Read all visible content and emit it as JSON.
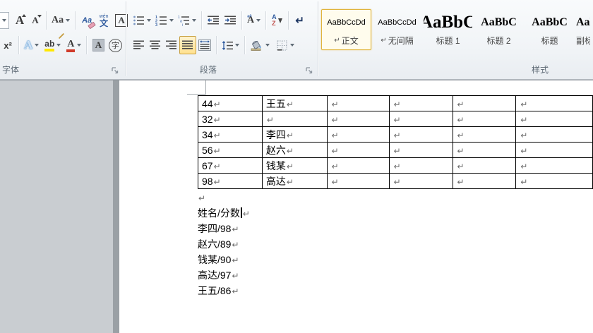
{
  "colors": {
    "ribbon_bg": "#f1f4f7",
    "selected_toggle_fill": "#ffe18f",
    "selected_toggle_border": "#c79f3f",
    "style_selected_border": "#e0b43c",
    "highlight_yellow": "#ffe800",
    "font_color_red": "#d03a2a",
    "canvas_gray": "#c9cdd1",
    "table_border": "#000000"
  },
  "ribbon": {
    "font": {
      "label": "字体",
      "grow_glyph": "A",
      "shrink_glyph": "A",
      "change_case_glyph": "Aa",
      "clear_format_glyph": "Aa",
      "phonetic_top": "wén",
      "phonetic_bottom": "文",
      "char_border_glyph": "A",
      "superscript_glyph": "x²",
      "text_effects_glyph": "A",
      "highlight_glyph": "ab",
      "font_color_glyph": "A",
      "char_shading_glyph": "A",
      "enclose_glyph": "字"
    },
    "paragraph": {
      "label": "段落",
      "sort_a": "A",
      "sort_z": "Z",
      "asian_layout_glyph": "A",
      "show_marks_glyph": "↵"
    },
    "styles": {
      "label": "样式",
      "items": [
        {
          "sample": "AaBbCcDd",
          "mark": "↵",
          "name": "正文"
        },
        {
          "sample": "AaBbCcDd",
          "mark": "↵",
          "name": "无间隔"
        },
        {
          "sample": "AaBbC",
          "name": "标题 1"
        },
        {
          "sample": "AaBbC",
          "name": "标题 2"
        },
        {
          "sample": "AaBbC",
          "name": "标题"
        },
        {
          "sample": "AaBb",
          "name": "副标题"
        }
      ]
    }
  },
  "document": {
    "pilcrow": "↵",
    "table": {
      "rows": [
        [
          "44",
          "王五",
          "",
          "",
          "",
          ""
        ],
        [
          "32",
          "",
          "",
          "",
          "",
          ""
        ],
        [
          "34",
          "李四",
          "",
          "",
          "",
          ""
        ],
        [
          "56",
          "赵六",
          "",
          "",
          "",
          ""
        ],
        [
          "67",
          "钱某",
          "",
          "",
          "",
          ""
        ],
        [
          "98",
          "高达",
          "",
          "",
          "",
          ""
        ]
      ]
    },
    "lines": [
      "姓名/分数",
      "李四/98",
      "赵六/89",
      "钱某/90",
      "高达/97",
      "王五/86"
    ]
  }
}
